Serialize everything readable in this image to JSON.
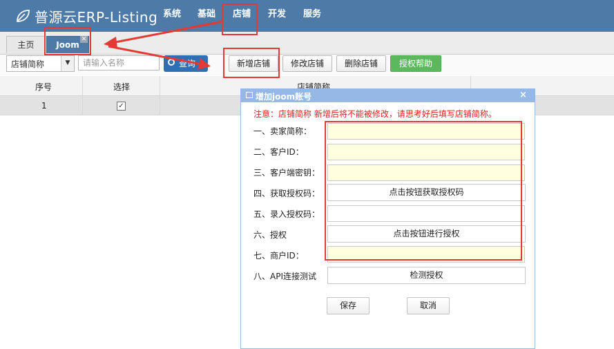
{
  "app": {
    "logo_text": "普源云ERP-Listing",
    "nav": [
      "系统",
      "基础",
      "店铺",
      "开发",
      "服务"
    ],
    "active_nav": "店铺"
  },
  "tabs": [
    {
      "label": "主页",
      "active": false
    },
    {
      "label": "Joom",
      "active": true,
      "closable": true
    }
  ],
  "toolbar": {
    "search_field_select": "店铺简称",
    "search_placeholder": "请输入名称",
    "query_label": "查询",
    "buttons": [
      "新增店铺",
      "修改店铺",
      "删除店铺",
      "授权帮助"
    ]
  },
  "grid": {
    "columns": [
      "序号",
      "选择",
      "店铺简称"
    ],
    "rows": [
      {
        "index": "1",
        "checked": true
      }
    ]
  },
  "dialog": {
    "title": "增加joom账号",
    "notice": "注意：店铺简称 新增后将不能被修改，请思考好后填写店铺简称。",
    "fields": [
      {
        "label": "一、卖家简称：",
        "type": "input",
        "value": ""
      },
      {
        "label": "二、客户ID：",
        "type": "input",
        "value": ""
      },
      {
        "label": "三、客户端密钥：",
        "type": "input",
        "value": ""
      },
      {
        "label": "四、获取授权码：",
        "type": "button",
        "button_label": "点击按钮获取授权码"
      },
      {
        "label": "五、录入授权码：",
        "type": "input",
        "value": ""
      },
      {
        "label": "六、授权",
        "type": "button",
        "button_label": "点击按钮进行授权"
      },
      {
        "label": "七、商户ID：",
        "type": "input",
        "value": ""
      },
      {
        "label": "八、API连接测试",
        "type": "button",
        "button_label": "检测授权"
      }
    ],
    "save_label": "保存",
    "cancel_label": "取消"
  },
  "colors": {
    "header_bg": "#4d7aa6",
    "dialog_title_bg": "#95b8e7",
    "annotation_red": "#e53935",
    "highlight_input_bg": "#ffffe0",
    "auth_help_green": "#5cb85c"
  }
}
